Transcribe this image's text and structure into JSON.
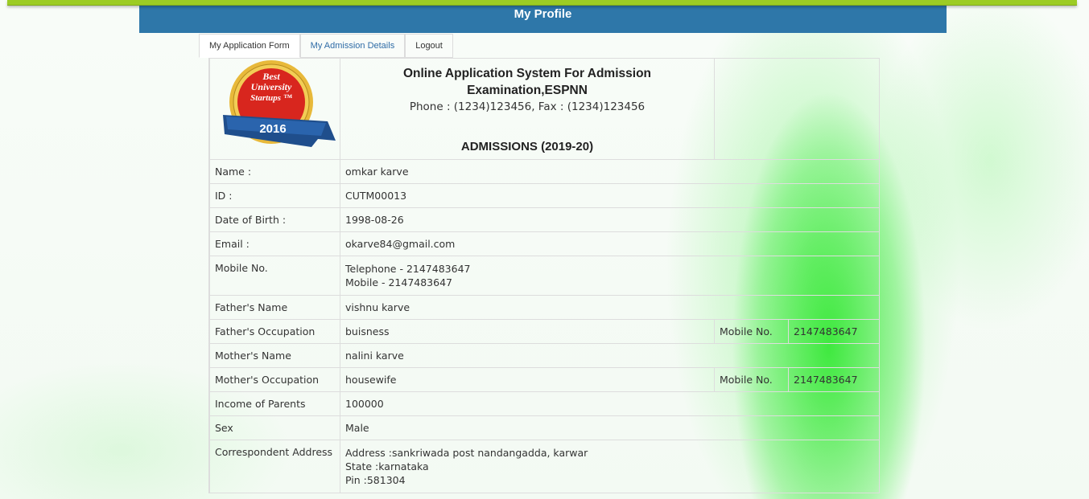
{
  "header": {
    "title": "My Profile"
  },
  "tabs": [
    {
      "label": "My Application Form"
    },
    {
      "label": "My Admission Details"
    },
    {
      "label": "Logout"
    }
  ],
  "logo": {
    "line1": "Best",
    "line2": "University",
    "line3": "Startups ™",
    "year": "2016"
  },
  "org": {
    "name": "Online Application System For Admission Examination,ESPNN",
    "contact": "Phone : (1234)123456, Fax : (1234)123456",
    "admissions": "ADMISSIONS (2019-20)"
  },
  "profile": {
    "name_label": "Name :",
    "name_value": "omkar karve",
    "id_label": "ID :",
    "id_value": "CUTM00013",
    "dob_label": "Date of Birth :",
    "dob_value": "1998-08-26",
    "email_label": "Email :",
    "email_value": "okarve84@gmail.com",
    "mobile_label": "Mobile No.",
    "telephone_value": "Telephone - 2147483647",
    "mobile_value": "Mobile - 2147483647",
    "father_name_label": "Father's Name",
    "father_name_value": "vishnu karve",
    "father_occ_label": "Father's Occupation",
    "father_occ_value": "buisness",
    "father_mobile_label": "Mobile No.",
    "father_mobile_value": "2147483647",
    "mother_name_label": "Mother's Name",
    "mother_name_value": "nalini karve",
    "mother_occ_label": "Mother's Occupation",
    "mother_occ_value": "housewife",
    "mother_mobile_label": "Mobile No.",
    "mother_mobile_value": "2147483647",
    "income_label": "Income of Parents",
    "income_value": "100000",
    "sex_label": "Sex",
    "sex_value": "Male",
    "address_label": "Correspondent Address",
    "address_line": "Address :sankriwada post nandangadda, karwar",
    "state_line": "State :karnataka",
    "pin_line": "Pin :581304"
  }
}
